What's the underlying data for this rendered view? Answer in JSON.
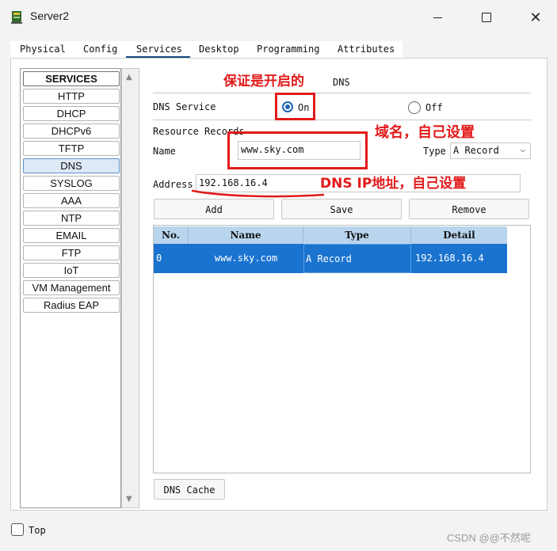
{
  "window": {
    "title": "Server2"
  },
  "tabs": [
    "Physical",
    "Config",
    "Services",
    "Desktop",
    "Programming",
    "Attributes"
  ],
  "sidebar": {
    "header": "SERVICES",
    "items": [
      "HTTP",
      "DHCP",
      "DHCPv6",
      "TFTP",
      "DNS",
      "SYSLOG",
      "AAA",
      "NTP",
      "EMAIL",
      "FTP",
      "IoT",
      "VM Management",
      "Radius EAP"
    ],
    "selected": "DNS"
  },
  "dns": {
    "heading": "DNS",
    "service_label": "DNS Service",
    "on_label": "On",
    "off_label": "Off",
    "resource_records_label": "Resource Records",
    "name_label": "Name",
    "name_value": "www.sky.com",
    "type_label": "Type",
    "type_value": "A Record",
    "address_label": "Address",
    "address_value": "192.168.16.4",
    "add_label": "Add",
    "save_label": "Save",
    "remove_label": "Remove",
    "cache_label": "DNS Cache"
  },
  "table": {
    "columns": [
      "No.",
      "Name",
      "Type",
      "Detail"
    ],
    "rows": [
      {
        "no": "0",
        "name": "www.sky.com",
        "type": "A Record",
        "detail": "192.168.16.4"
      }
    ]
  },
  "annotations": {
    "on_note": "保证是开启的",
    "name_note": "域名，自己设置",
    "address_note": "DNS IP地址，自己设置"
  },
  "bottom": {
    "top_label": "Top"
  },
  "watermark": "CSDN @@不然呢",
  "colors": {
    "accent": "#1a73cf",
    "annotation": "#e21a1a",
    "header_row": "#b9d5ee"
  }
}
